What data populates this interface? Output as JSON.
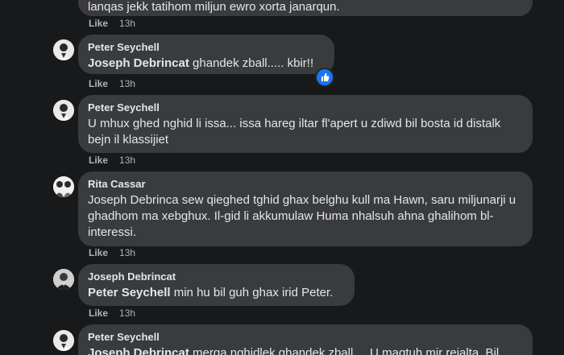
{
  "comments": [
    {
      "name": "",
      "text": "lanqas jekk tatihom miljun ewro xorta janarqun.",
      "like": "Like",
      "time": "13h"
    },
    {
      "name": "Peter Seychell",
      "mention": "Joseph Debrincat",
      "text": " ghandek zball..... kbir!!",
      "like": "Like",
      "time": "13h",
      "reaction": "like-reaction-icon"
    },
    {
      "name": "Peter Seychell",
      "text": "U mhux ghed nghid li issa... issa hareg iltar fl'apert u zdiwd bil bosta id distalk bejn il klassijiet",
      "like": "Like",
      "time": "13h"
    },
    {
      "name": "Rita Cassar",
      "text": "Joseph Debrinca sew qieghed tghid ghax belghu kull ma Hawn, saru miljunarji u ghadhom ma xebghux. Il-gid li akkumulaw Huma nhalsuh ahna ghalihom bl-interessi.",
      "like": "Like",
      "time": "13h"
    },
    {
      "name": "Joseph Debrincat",
      "mention": "Peter Seychell",
      "text": " min hu bil guh ghax irid Peter.",
      "like": "Like",
      "time": "13h"
    },
    {
      "name": "Peter Seychell",
      "mention": "Joseph Debrincat",
      "text": " merqa nghidlek ghandek zball.... U maqtuh mir rejalta. Bil",
      "like": "Like",
      "time": "13h"
    }
  ],
  "colors": {
    "background": "#18191a",
    "bubble": "#3a3b3c",
    "reaction": "#1877f2"
  }
}
